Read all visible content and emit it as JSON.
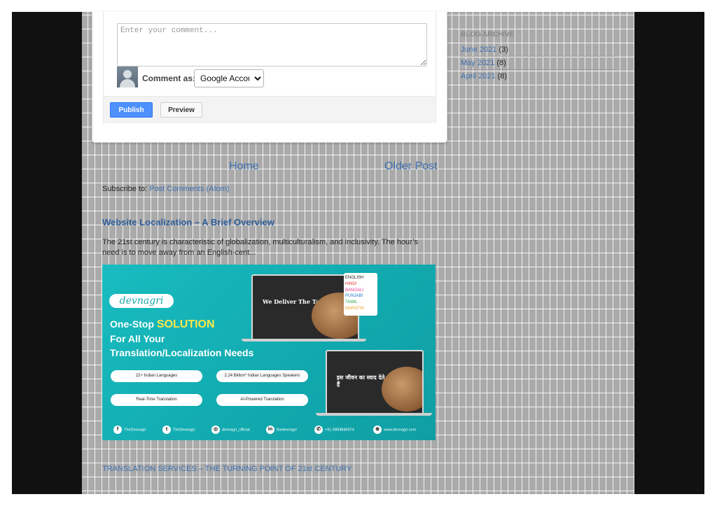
{
  "comment_form": {
    "placeholder": "Enter your comment...",
    "comment_as_label": "Comment as:",
    "account_selected": "Google Accoun",
    "publish_label": "Publish",
    "preview_label": "Preview"
  },
  "pager": {
    "home": "Home",
    "older": "Older Post"
  },
  "subscribe": {
    "prefix": "Subscribe to: ",
    "link": "Post Comments (Atom)"
  },
  "post": {
    "title": "Website Localization – A Brief Overview",
    "snippet": "The 21st century is characteristic of globalization, multiculturalism, and inclusivity. The hour’s need is to move away from an English-cent..."
  },
  "banner": {
    "logo": "devnagri",
    "headline_prefix": "One-Stop ",
    "headline_highlight": "SOLUTION",
    "headline_line2": "For All Your",
    "headline_line3": "Translation/Localization Needs",
    "features": [
      "22+ Indian Languages",
      "2.24 Billion* Indian Languages Speakers",
      "Real-Time Translation",
      "AI-Powered Translation"
    ],
    "screen1_text": "We Deliver The Taste Of Life",
    "screen2_text": "इस जीवन का स्वाद देते हैं",
    "languages": [
      {
        "name": "ENGLISH",
        "color": "#222222"
      },
      {
        "name": "HINDI",
        "color": "#e0322d"
      },
      {
        "name": "BANGALI",
        "color": "#e03a8a"
      },
      {
        "name": "PUNJABI",
        "color": "#1f78c8"
      },
      {
        "name": "TAMIL",
        "color": "#2aa84a"
      },
      {
        "name": "MARATHI",
        "color": "#e8a320"
      }
    ],
    "social": [
      {
        "icon": "facebook-icon",
        "glyph": "f",
        "label": "TheDevnagri"
      },
      {
        "icon": "twitter-icon",
        "glyph": "t",
        "label": "TheDevnagri"
      },
      {
        "icon": "instagram-icon",
        "glyph": "◎",
        "label": "devnagri_official"
      },
      {
        "icon": "linkedin-icon",
        "glyph": "in",
        "label": "thedevnagri"
      },
      {
        "icon": "whatsapp-icon",
        "glyph": "✆",
        "label": "+91-9899846974"
      },
      {
        "icon": "globe-icon",
        "glyph": "⊕",
        "label": "www.devnagri.com"
      }
    ]
  },
  "next_post": {
    "title": "TRANSLATION SERVICES – THE TURNING POINT OF 21st CENTURY"
  },
  "sidebar": {
    "archive_title": "BLOG ARCHIVE",
    "items": [
      {
        "month": "June 2021",
        "count": "(3)"
      },
      {
        "month": "May 2021",
        "count": "(8)"
      },
      {
        "month": "April 2021",
        "count": "(8)"
      }
    ]
  }
}
